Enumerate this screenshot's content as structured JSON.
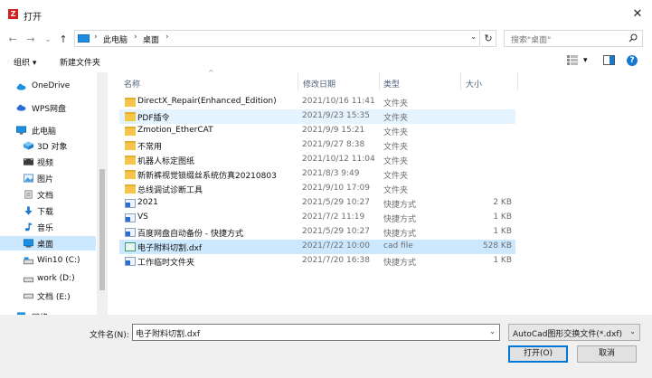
{
  "window": {
    "title": "打开",
    "close_glyph": "✕"
  },
  "nav_buttons": {
    "back": "←",
    "forward": "→",
    "recent": "⌄",
    "up": "↑"
  },
  "address": {
    "crumbs": [
      "此电脑",
      "桌面"
    ],
    "separator": "›",
    "dropdown": "⌄",
    "refresh": "↻"
  },
  "search": {
    "placeholder": "搜索\"桌面\""
  },
  "toolbar": {
    "organize": "组织 ▾",
    "new_folder": "新建文件夹",
    "view_dropdown": "▾",
    "help": "?"
  },
  "nav": {
    "items": [
      {
        "label": "OneDrive",
        "icon": "cloud-icon"
      },
      {
        "label": "WPS网盘",
        "icon": "wps-cloud-icon"
      },
      {
        "label": "此电脑",
        "icon": "computer-icon"
      },
      {
        "label": "3D 对象",
        "icon": "3d-objects-icon"
      },
      {
        "label": "视频",
        "icon": "video-icon"
      },
      {
        "label": "图片",
        "icon": "pictures-icon"
      },
      {
        "label": "文档",
        "icon": "documents-icon"
      },
      {
        "label": "下载",
        "icon": "download-icon"
      },
      {
        "label": "音乐",
        "icon": "music-icon"
      },
      {
        "label": "桌面",
        "icon": "desktop-icon",
        "selected": true
      },
      {
        "label": "Win10 (C:)",
        "icon": "drive-icon"
      },
      {
        "label": "work (D:)",
        "icon": "drive-icon"
      },
      {
        "label": "文档 (E:)",
        "icon": "drive-icon"
      },
      {
        "label": "网络",
        "icon": "network-icon"
      }
    ]
  },
  "columns": {
    "name": "名称",
    "date": "修改日期",
    "type": "类型",
    "size": "大小",
    "sort_glyph": "^"
  },
  "files": [
    {
      "name": "DirectX_Repair(Enhanced_Edition)",
      "date": "2021/10/16 11:41",
      "type": "文件夹",
      "size": "",
      "kind": "folder"
    },
    {
      "name": "PDF插令",
      "date": "2021/9/23 15:35",
      "type": "文件夹",
      "size": "",
      "kind": "folder",
      "hover": true
    },
    {
      "name": "Zmotion_EtherCAT",
      "date": "2021/9/9 15:21",
      "type": "文件夹",
      "size": "",
      "kind": "folder"
    },
    {
      "name": "不常用",
      "date": "2021/9/27 8:38",
      "type": "文件夹",
      "size": "",
      "kind": "folder"
    },
    {
      "name": "机器人标定图纸",
      "date": "2021/10/12 11:04",
      "type": "文件夹",
      "size": "",
      "kind": "folder"
    },
    {
      "name": "新新裤视觉锁缀丝系统仿真20210803",
      "date": "2021/8/3 9:49",
      "type": "文件夹",
      "size": "",
      "kind": "folder"
    },
    {
      "name": "总线调试诊断工具",
      "date": "2021/9/10 17:09",
      "type": "文件夹",
      "size": "",
      "kind": "folder"
    },
    {
      "name": "2021",
      "date": "2021/5/29 10:27",
      "type": "快捷方式",
      "size": "2 KB",
      "kind": "link"
    },
    {
      "name": "VS",
      "date": "2021/7/2 11:19",
      "type": "快捷方式",
      "size": "1 KB",
      "kind": "link"
    },
    {
      "name": "百度网盘自动备份 - 快捷方式",
      "date": "2021/5/29 10:27",
      "type": "快捷方式",
      "size": "1 KB",
      "kind": "link"
    },
    {
      "name": "电子附料切割.dxf",
      "date": "2021/7/22 10:00",
      "type": "cad file",
      "size": "528 KB",
      "kind": "dxf",
      "selected": true
    },
    {
      "name": "工作临时文件夹",
      "date": "2021/7/20 16:38",
      "type": "快捷方式",
      "size": "1 KB",
      "kind": "link"
    }
  ],
  "footer": {
    "filename_label": "文件名(N):",
    "filename_value": "电子附料切割.dxf",
    "filetype_value": "AutoCad图形交换文件(*.dxf)",
    "dropdown": "⌄",
    "open_button": "打开(O)",
    "cancel_button": "取消"
  },
  "colors": {
    "selection": "#cce8ff",
    "hover": "#e5f3ff",
    "accent": "#0078d7",
    "folder": "#f4c64c"
  }
}
